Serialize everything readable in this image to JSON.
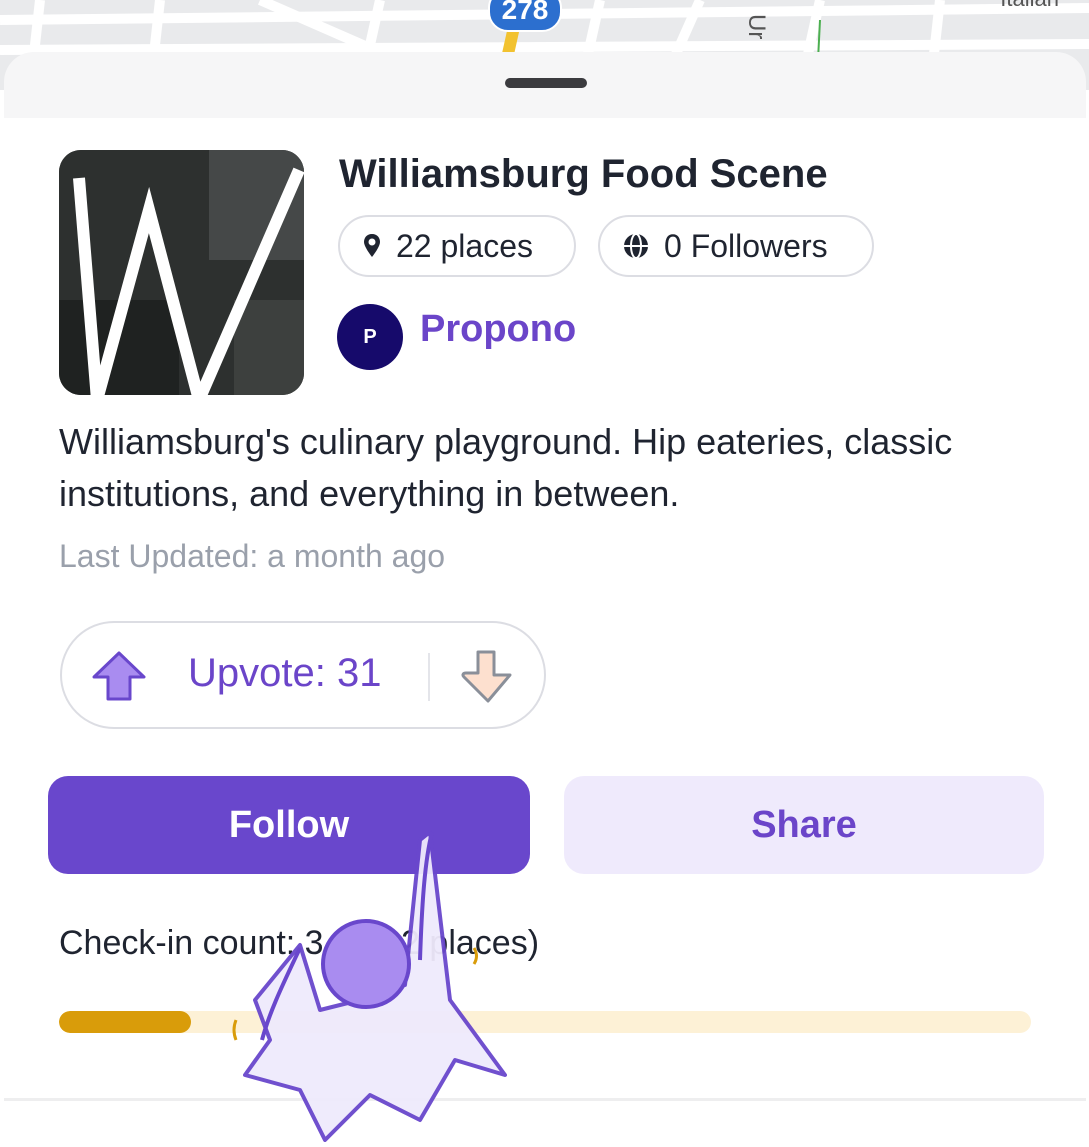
{
  "map": {
    "highway_badge": "278",
    "street_label": "Ur",
    "corner_label": "Italian"
  },
  "list": {
    "title": "Williamsburg Food Scene",
    "places_chip": "22 places",
    "followers_chip": "0 Followers",
    "creator": {
      "initial": "P",
      "name": "Propono",
      "avatar_color": "#160a6b"
    },
    "description": "Williamsburg's culinary playground. Hip eateries, classic institutions, and everything in between.",
    "last_updated": "Last Updated: a month ago"
  },
  "votes": {
    "upvote_label": "Upvote: 31",
    "upvote_count": 31
  },
  "actions": {
    "follow_label": "Follow",
    "share_label": "Share"
  },
  "checkin": {
    "label": "Check-in count: 3 (of 22 places)",
    "progress_fraction": 0.136
  },
  "colors": {
    "accent": "#6947cc",
    "accent_light": "#efeafc",
    "progress": "#d99c0a",
    "progress_track": "#fdf1d6"
  },
  "icons": [
    "location-pin-icon",
    "globe-icon",
    "upvote-arrow-icon",
    "downvote-hand-icon",
    "drag-handle",
    "tap-gesture-overlay"
  ]
}
